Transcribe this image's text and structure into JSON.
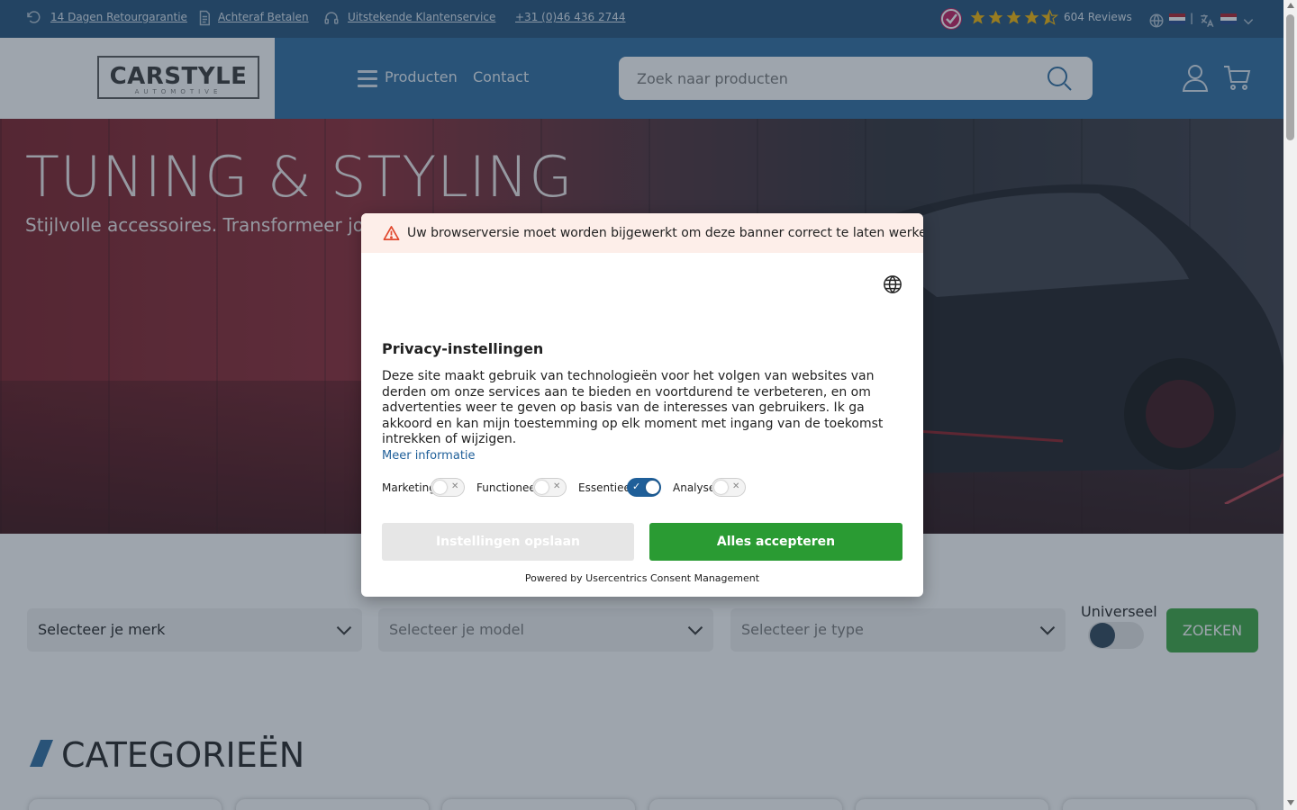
{
  "topbar": {
    "links": [
      {
        "label": "14 Dagen Retourgarantie",
        "icon": "return-arrow-icon"
      },
      {
        "label": "Achteraf Betalen",
        "icon": "invoice-icon"
      },
      {
        "label": "Uitstekende Klantenservice",
        "icon": "headset-icon"
      },
      {
        "label": "+31 (0)46 436 2744"
      }
    ],
    "reviews": {
      "count_label": "604 Reviews",
      "rating": 4.5,
      "max": 5
    },
    "separator": "|"
  },
  "header": {
    "logo_text": "CARSTYLE",
    "logo_sub": "AUTOMOTIVE",
    "nav": [
      {
        "label": "Producten"
      },
      {
        "label": "Contact"
      }
    ],
    "search_placeholder": "Zoek naar producten"
  },
  "hero": {
    "title": "TUNING & STYLING",
    "subtitle": "Stijlvolle accessoires. Transformeer jouw"
  },
  "filter": {
    "selects": [
      {
        "label": "Selecteer je merk"
      },
      {
        "label": "Selecteer je model"
      },
      {
        "label": "Selecteer je type"
      }
    ],
    "universal_label": "Universeel",
    "search_button": "ZOEKEN"
  },
  "categories": {
    "title": "CATEGORIEËN"
  },
  "consent": {
    "warning": "Uw browserversie moet worden bijgewerkt om deze banner correct te laten werken.",
    "title": "Privacy-instellingen",
    "description": "Deze site maakt gebruik van technologieën voor het volgen van websites van derden om onze services aan te bieden en voortdurend te verbeteren, en om advertenties weer te geven op basis van de interesses van gebruikers. Ik ga akkoord en kan mijn toestemming op elk moment met ingang van de toekomst intrekken of wijzigen.",
    "more_info": "Meer informatie",
    "toggles": [
      {
        "label": "Marketing",
        "on": false
      },
      {
        "label": "Functioneel",
        "on": false
      },
      {
        "label": "Essentieel",
        "on": true
      },
      {
        "label": "Analyse",
        "on": false
      }
    ],
    "save_button": "Instellingen opslaan",
    "accept_button": "Alles accepteren",
    "powered_by": "Powered by Usercentrics Consent Management"
  },
  "colors": {
    "topbar": "#1f4f78",
    "header": "#2b6a9e",
    "accept": "#2a9b33",
    "toggle_on": "#1f5f99",
    "warning_bg": "#fdeee9"
  }
}
